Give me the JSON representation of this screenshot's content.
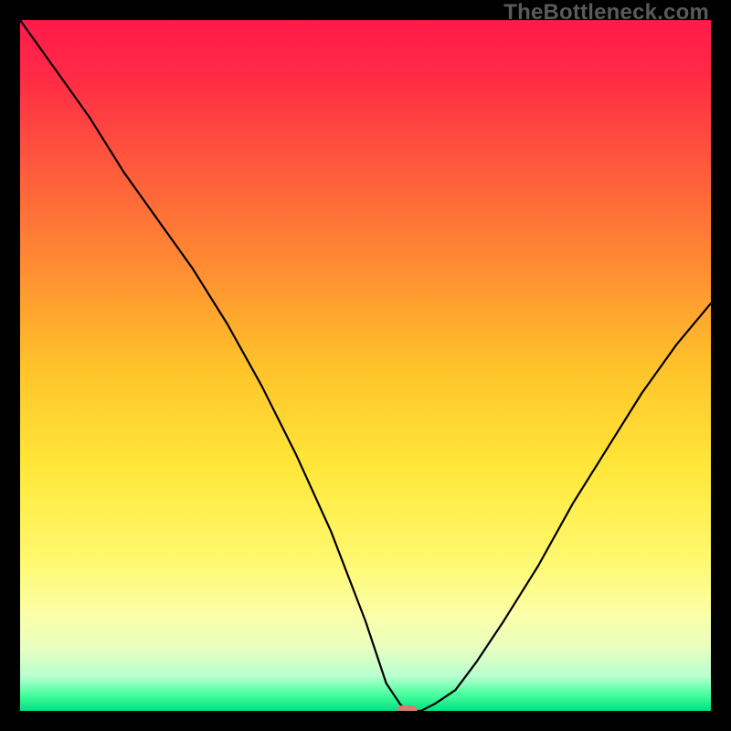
{
  "watermark": "TheBottleneck.com",
  "chart_data": {
    "type": "line",
    "title": "",
    "xlabel": "",
    "ylabel": "",
    "xlim": [
      0,
      100
    ],
    "ylim": [
      0,
      100
    ],
    "grid": false,
    "background_gradient": [
      {
        "stop": 0.0,
        "color": "#ff1a4b"
      },
      {
        "stop": 0.08,
        "color": "#ff2a45"
      },
      {
        "stop": 0.2,
        "color": "#ff553d"
      },
      {
        "stop": 0.35,
        "color": "#ff8a33"
      },
      {
        "stop": 0.5,
        "color": "#ffc22a"
      },
      {
        "stop": 0.65,
        "color": "#ffe83a"
      },
      {
        "stop": 0.78,
        "color": "#fff86e"
      },
      {
        "stop": 0.86,
        "color": "#fbffa7"
      },
      {
        "stop": 0.91,
        "color": "#e7ffc2"
      },
      {
        "stop": 0.95,
        "color": "#b7ffcf"
      },
      {
        "stop": 0.975,
        "color": "#4effa0"
      },
      {
        "stop": 1.0,
        "color": "#00e183"
      }
    ],
    "series": [
      {
        "name": "bottleneck-curve",
        "x": [
          0,
          5,
          10,
          15,
          20,
          25,
          30,
          35,
          40,
          45,
          50,
          53,
          55,
          56,
          57,
          58,
          60,
          63,
          66,
          70,
          75,
          80,
          85,
          90,
          95,
          100
        ],
        "y": [
          100,
          93,
          86,
          78,
          71,
          64,
          56,
          47,
          37,
          26,
          13,
          4,
          1,
          0,
          0,
          0,
          1,
          3,
          7,
          13,
          21,
          30,
          38,
          46,
          53,
          59
        ]
      }
    ],
    "marker": {
      "name": "optimal-point",
      "x": 56,
      "y": 0,
      "color": "#d97b6e",
      "width_pct": 3.0,
      "height_pct": 1.6
    }
  }
}
